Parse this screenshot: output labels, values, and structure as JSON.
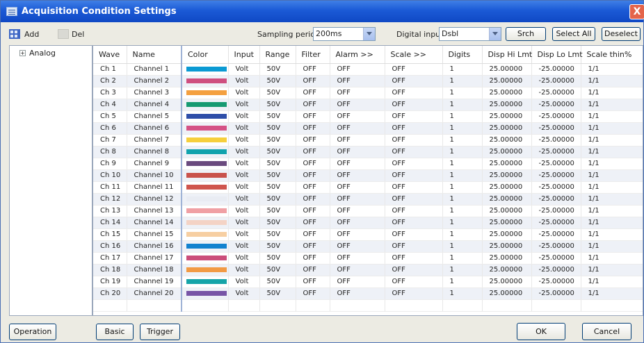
{
  "window": {
    "title": "Acquisition Condition Settings",
    "close_glyph": "X"
  },
  "toolbar": {
    "add_label": "Add",
    "del_label": "Del",
    "sampling_label": "Sampling period",
    "sampling_value": "200ms",
    "digital_label": "Digital input",
    "digital_value": "Dsbl",
    "srch_label": "Srch",
    "select_all_label": "Select All",
    "deselect_label": "Deselect"
  },
  "tree": {
    "root_label": "Analog",
    "expand_glyph": "+"
  },
  "grid": {
    "headers": [
      "Wave",
      "Name",
      "Color",
      "Input",
      "Range",
      "Filter",
      "Alarm >>",
      "Scale >>",
      "Digits",
      "Disp Hi Lmt",
      "Disp Lo Lmt",
      "Scale thin%"
    ],
    "rows": [
      {
        "wave": "Ch 1",
        "name": "Channel 1",
        "color": "#0b9ad3",
        "input": "Volt",
        "range": "50V",
        "filter": "OFF",
        "alarm": "OFF",
        "scale": "OFF",
        "digits": "1",
        "hi": "25.00000",
        "lo": "-25.00000",
        "thin": "1/1"
      },
      {
        "wave": "Ch 2",
        "name": "Channel 2",
        "color": "#cf4f7f",
        "input": "Volt",
        "range": "50V",
        "filter": "OFF",
        "alarm": "OFF",
        "scale": "OFF",
        "digits": "1",
        "hi": "25.00000",
        "lo": "-25.00000",
        "thin": "1/1"
      },
      {
        "wave": "Ch 3",
        "name": "Channel 3",
        "color": "#f4a040",
        "input": "Volt",
        "range": "50V",
        "filter": "OFF",
        "alarm": "OFF",
        "scale": "OFF",
        "digits": "1",
        "hi": "25.00000",
        "lo": "-25.00000",
        "thin": "1/1"
      },
      {
        "wave": "Ch 4",
        "name": "Channel 4",
        "color": "#169a71",
        "input": "Volt",
        "range": "50V",
        "filter": "OFF",
        "alarm": "OFF",
        "scale": "OFF",
        "digits": "1",
        "hi": "25.00000",
        "lo": "-25.00000",
        "thin": "1/1"
      },
      {
        "wave": "Ch 5",
        "name": "Channel 5",
        "color": "#2e4ea8",
        "input": "Volt",
        "range": "50V",
        "filter": "OFF",
        "alarm": "OFF",
        "scale": "OFF",
        "digits": "1",
        "hi": "25.00000",
        "lo": "-25.00000",
        "thin": "1/1"
      },
      {
        "wave": "Ch 6",
        "name": "Channel 6",
        "color": "#d55285",
        "input": "Volt",
        "range": "50V",
        "filter": "OFF",
        "alarm": "OFF",
        "scale": "OFF",
        "digits": "1",
        "hi": "25.00000",
        "lo": "-25.00000",
        "thin": "1/1"
      },
      {
        "wave": "Ch 7",
        "name": "Channel 7",
        "color": "#f6cf3c",
        "input": "Volt",
        "range": "50V",
        "filter": "OFF",
        "alarm": "OFF",
        "scale": "OFF",
        "digits": "1",
        "hi": "25.00000",
        "lo": "-25.00000",
        "thin": "1/1"
      },
      {
        "wave": "Ch 8",
        "name": "Channel 8",
        "color": "#12a3ad",
        "input": "Volt",
        "range": "50V",
        "filter": "OFF",
        "alarm": "OFF",
        "scale": "OFF",
        "digits": "1",
        "hi": "25.00000",
        "lo": "-25.00000",
        "thin": "1/1"
      },
      {
        "wave": "Ch 9",
        "name": "Channel 9",
        "color": "#6a4a7e",
        "input": "Volt",
        "range": "50V",
        "filter": "OFF",
        "alarm": "OFF",
        "scale": "OFF",
        "digits": "1",
        "hi": "25.00000",
        "lo": "-25.00000",
        "thin": "1/1"
      },
      {
        "wave": "Ch 10",
        "name": "Channel 10",
        "color": "#c9524b",
        "input": "Volt",
        "range": "50V",
        "filter": "OFF",
        "alarm": "OFF",
        "scale": "OFF",
        "digits": "1",
        "hi": "25.00000",
        "lo": "-25.00000",
        "thin": "1/1"
      },
      {
        "wave": "Ch 11",
        "name": "Channel 11",
        "color": "#cf554d",
        "input": "Volt",
        "range": "50V",
        "filter": "OFF",
        "alarm": "OFF",
        "scale": "OFF",
        "digits": "1",
        "hi": "25.00000",
        "lo": "-25.00000",
        "thin": "1/1"
      },
      {
        "wave": "Ch 12",
        "name": "Channel 12",
        "color": "#e9ecf3",
        "input": "Volt",
        "range": "50V",
        "filter": "OFF",
        "alarm": "OFF",
        "scale": "OFF",
        "digits": "1",
        "hi": "25.00000",
        "lo": "-25.00000",
        "thin": "1/1"
      },
      {
        "wave": "Ch 13",
        "name": "Channel 13",
        "color": "#f0a0a4",
        "input": "Volt",
        "range": "50V",
        "filter": "OFF",
        "alarm": "OFF",
        "scale": "OFF",
        "digits": "1",
        "hi": "25.00000",
        "lo": "-25.00000",
        "thin": "1/1"
      },
      {
        "wave": "Ch 14",
        "name": "Channel 14",
        "color": "#f4d3c5",
        "input": "Volt",
        "range": "50V",
        "filter": "OFF",
        "alarm": "OFF",
        "scale": "OFF",
        "digits": "1",
        "hi": "25.00000",
        "lo": "-25.00000",
        "thin": "1/1"
      },
      {
        "wave": "Ch 15",
        "name": "Channel 15",
        "color": "#f7cfa2",
        "input": "Volt",
        "range": "50V",
        "filter": "OFF",
        "alarm": "OFF",
        "scale": "OFF",
        "digits": "1",
        "hi": "25.00000",
        "lo": "-25.00000",
        "thin": "1/1"
      },
      {
        "wave": "Ch 16",
        "name": "Channel 16",
        "color": "#1282cf",
        "input": "Volt",
        "range": "50V",
        "filter": "OFF",
        "alarm": "OFF",
        "scale": "OFF",
        "digits": "1",
        "hi": "25.00000",
        "lo": "-25.00000",
        "thin": "1/1"
      },
      {
        "wave": "Ch 17",
        "name": "Channel 17",
        "color": "#cb4d7a",
        "input": "Volt",
        "range": "50V",
        "filter": "OFF",
        "alarm": "OFF",
        "scale": "OFF",
        "digits": "1",
        "hi": "25.00000",
        "lo": "-25.00000",
        "thin": "1/1"
      },
      {
        "wave": "Ch 18",
        "name": "Channel 18",
        "color": "#f29a44",
        "input": "Volt",
        "range": "50V",
        "filter": "OFF",
        "alarm": "OFF",
        "scale": "OFF",
        "digits": "1",
        "hi": "25.00000",
        "lo": "-25.00000",
        "thin": "1/1"
      },
      {
        "wave": "Ch 19",
        "name": "Channel 19",
        "color": "#15a4a8",
        "input": "Volt",
        "range": "50V",
        "filter": "OFF",
        "alarm": "OFF",
        "scale": "OFF",
        "digits": "1",
        "hi": "25.00000",
        "lo": "-25.00000",
        "thin": "1/1"
      },
      {
        "wave": "Ch 20",
        "name": "Channel 20",
        "color": "#7855a6",
        "input": "Volt",
        "range": "50V",
        "filter": "OFF",
        "alarm": "OFF",
        "scale": "OFF",
        "digits": "1",
        "hi": "25.00000",
        "lo": "-25.00000",
        "thin": "1/1"
      }
    ]
  },
  "footer": {
    "operation_label": "Operation",
    "basic_label": "Basic",
    "trigger_label": "Trigger",
    "ok_label": "OK",
    "cancel_label": "Cancel"
  }
}
